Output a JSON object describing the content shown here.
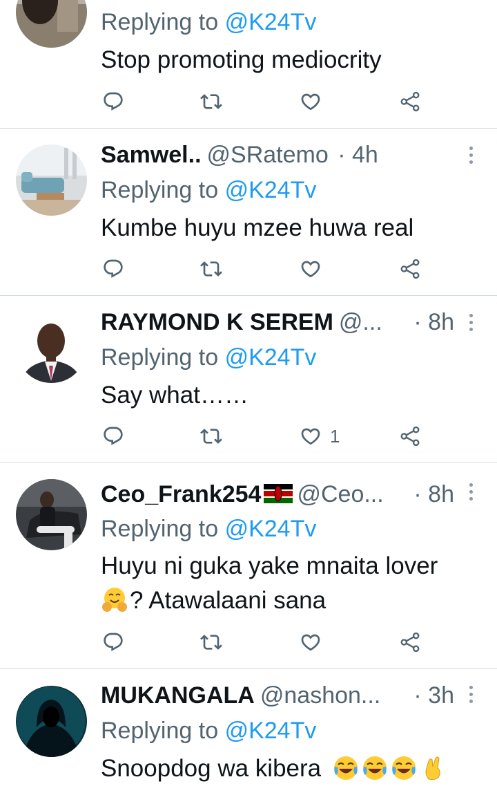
{
  "colors": {
    "link": "#1d9bf0",
    "muted": "#536471",
    "text": "#0f1419",
    "divider": "#cfd9de"
  },
  "tweets": [
    {
      "replying_prefix": "Replying to",
      "replying_handle": "@K24Tv",
      "text": "Stop promoting mediocrity",
      "like_count": "",
      "icons": [
        "reply-icon",
        "retweet-icon",
        "like-icon",
        "share-icon"
      ]
    },
    {
      "name": "Samwel..",
      "handle": "@SRatemo",
      "time": "· 4h",
      "replying_prefix": "Replying to",
      "replying_handle": "@K24Tv",
      "text": "Kumbe huyu mzee huwa real",
      "like_count": ""
    },
    {
      "name": "RAYMOND K SEREM",
      "handle": "@...",
      "time": "· 8h",
      "replying_prefix": "Replying to",
      "replying_handle": "@K24Tv",
      "text": "Say what……",
      "like_count": "1"
    },
    {
      "name": "Ceo_Frank254",
      "name_emoji": "kenya-flag-icon",
      "handle": "@Ceo...",
      "time": "· 8h",
      "replying_prefix": "Replying to",
      "replying_handle": "@K24Tv",
      "text_line1": "Huyu ni guka yake mnaita lover",
      "text_line2": "? Atawalaani sana",
      "text_emoji": "hugging-face-icon",
      "like_count": ""
    },
    {
      "name": "MUKANGALA",
      "handle": "@nashon...",
      "time": "· 3h",
      "replying_prefix": "Replying to",
      "replying_handle": "@K24Tv",
      "text": "Snoopdog wa kibera",
      "text_emojis": [
        "crying-laughing-icon",
        "crying-laughing-icon",
        "crying-laughing-icon",
        "pinching-hand-icon"
      ]
    }
  ]
}
